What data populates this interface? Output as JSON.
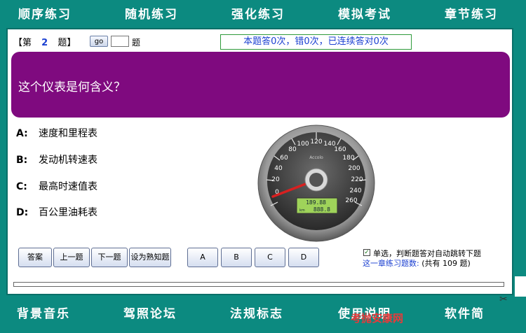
{
  "top_nav": [
    "顺序练习",
    "随机练习",
    "强化练习",
    "模拟考试",
    "章节练习"
  ],
  "header": {
    "q_prefix": "【第",
    "q_number": "2",
    "q_suffix": "题】",
    "go_label": "go",
    "go_input_value": "",
    "unit_label": "题",
    "stats": "本题答0次，错0次，已连续答对0次"
  },
  "question": {
    "text": "这个仪表是何含义？"
  },
  "options": [
    {
      "key": "A:",
      "text": "速度和里程表"
    },
    {
      "key": "B:",
      "text": "发动机转速表"
    },
    {
      "key": "C:",
      "text": "最高时速值表"
    },
    {
      "key": "D:",
      "text": "百公里油耗表"
    }
  ],
  "gauge": {
    "brand": "Accolo",
    "odometer_top": "189.88",
    "odometer_bottom": "888.8",
    "unit_label": "km",
    "ticks": [
      "0",
      "20",
      "40",
      "60",
      "80",
      "100",
      "120",
      "140",
      "160",
      "180",
      "200",
      "220",
      "240",
      "260"
    ],
    "needle_value": 0
  },
  "buttons": {
    "answer": "答案",
    "prev": "上一题",
    "next": "下一题",
    "mark_known": "设为熟知题",
    "choice_a": "A",
    "choice_b": "B",
    "choice_c": "C",
    "choice_d": "D"
  },
  "auto_jump": {
    "checked": true,
    "mark": "✓",
    "label": "单选，判断题答对自动跳转下题"
  },
  "chapter": {
    "label": "这一章练习题数:",
    "total_text": "(共有   109   题)"
  },
  "progress": 0,
  "bottom_nav": [
    "背景音乐",
    "驾照论坛",
    "法规标志",
    "使用说明",
    "软件简"
  ],
  "watermark": "考抛安康网",
  "scissor_glyph": "✂"
}
